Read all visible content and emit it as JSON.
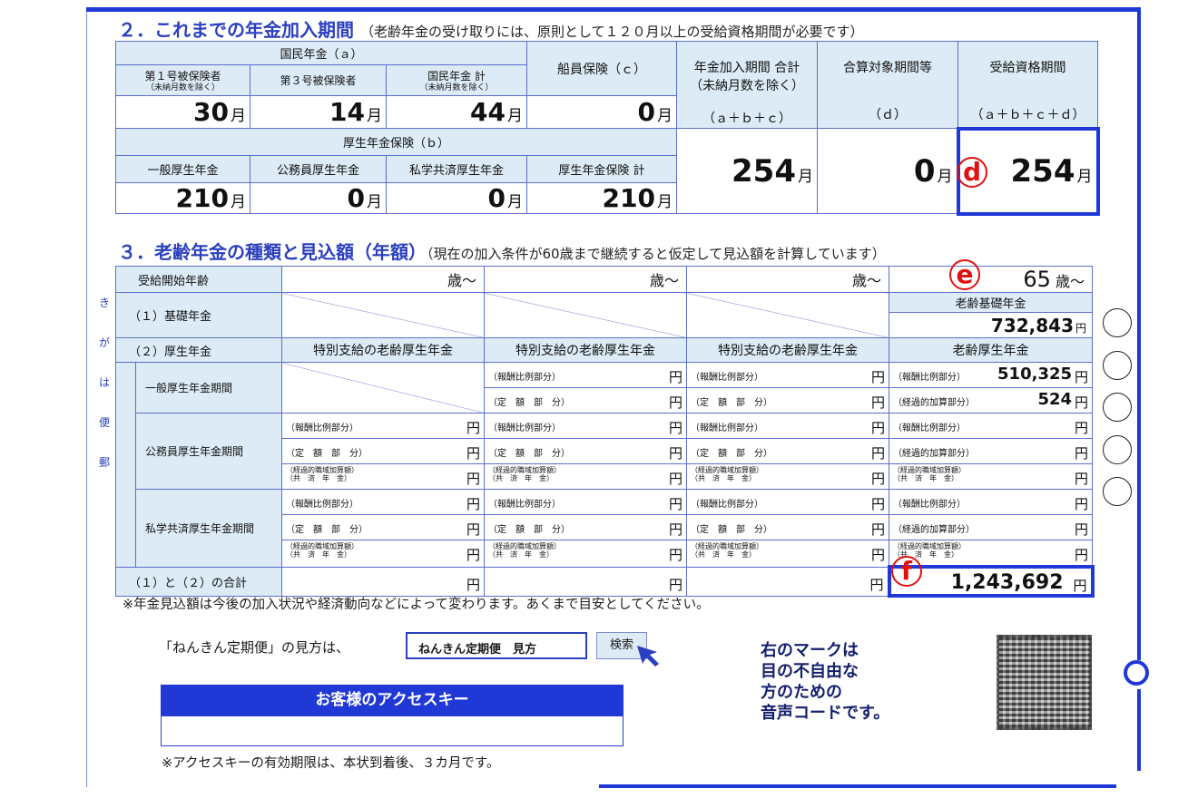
{
  "sec2": {
    "title": "２．これまでの年金加入期間",
    "note": "（老齢年金の受け取りには、原則として１２０月以上の受給資格期間が必要です）",
    "kokumin_header": "国民年金（ａ）",
    "col1": "第１号被保険者",
    "col1_sub": "（未納月数を除く）",
    "col2": "第３号被保険者",
    "col3": "国民年金 計",
    "col3_sub": "（未納月数を除く）",
    "col4": "船員保険（ｃ）",
    "col5": "年金加入期間 合計",
    "col5_sub": "（未納月数を除く）",
    "col5_formula": "（ａ＋ｂ＋ｃ）",
    "col6": "合算対象期間等",
    "col6_sub": "（ｄ）",
    "col7": "受給資格期間",
    "col7_formula": "（ａ＋ｂ＋ｃ＋ｄ）",
    "v1": "30",
    "v2": "14",
    "v3": "44",
    "v4": "0",
    "kousei_header": "厚生年金保険（ｂ）",
    "k1": "一般厚生年金",
    "k2": "公務員厚生年金",
    "k3": "私学共済厚生年金",
    "k4": "厚生年金保険 計",
    "kv1": "210",
    "kv2": "0",
    "kv3": "0",
    "kv4": "210",
    "total": "254",
    "gassan": "0",
    "jukyu": "254",
    "unit": "月"
  },
  "sec3": {
    "title": "３．老齢年金の種類と見込額（年額）",
    "note": "（現在の加入条件が60歳まで継続すると仮定して見込額を計算しています）",
    "start_age_label": "受給開始年齢",
    "age_suffix": "歳～",
    "age4": "65",
    "kiso_label": "（１）基礎年金",
    "kiso_header": "老齢基礎年金",
    "kiso_value": "732,843",
    "kousei_label": "（２）厚生年金",
    "tokubetsu": "特別支給の老齢厚生年金",
    "rourei_kousei": "老齢厚生年金",
    "ippan_period": "一般厚生年金期間",
    "koumuin_period": "公務員厚生年金期間",
    "shigaku_period": "私学共済厚生年金期間",
    "hoshu": "（報酬比例部分）",
    "teigaku": "（定　額　部　分）",
    "keika": "（経過的加算部分）",
    "shokuiki": "（経過的職域加算額）",
    "shokuiki2": "（共　済　年　金）",
    "hoshu_value": "510,325",
    "keika_value": "524",
    "total_label": "（１）と（２）の合計",
    "total_value": "1,243,692",
    "yen": "円"
  },
  "annotations": {
    "d": "d",
    "e": "e",
    "f": "f"
  },
  "side_text": [
    "き",
    "が",
    "は",
    "便",
    "郵"
  ],
  "footnote": "※年金見込額は今後の加入状況や経済動向などによって変わります。あくまで目安としてください。",
  "search": {
    "lead": "「ねんきん定期便」の見方は、",
    "query": "ねんきん定期便　見方",
    "button": "検索"
  },
  "access": {
    "title": "お客様のアクセスキー",
    "note": "※アクセスキーの有効期限は、本状到着後、３カ月です。"
  },
  "voice_code": [
    "右のマークは",
    "目の不自由な",
    "方のための",
    "音声コードです。"
  ]
}
